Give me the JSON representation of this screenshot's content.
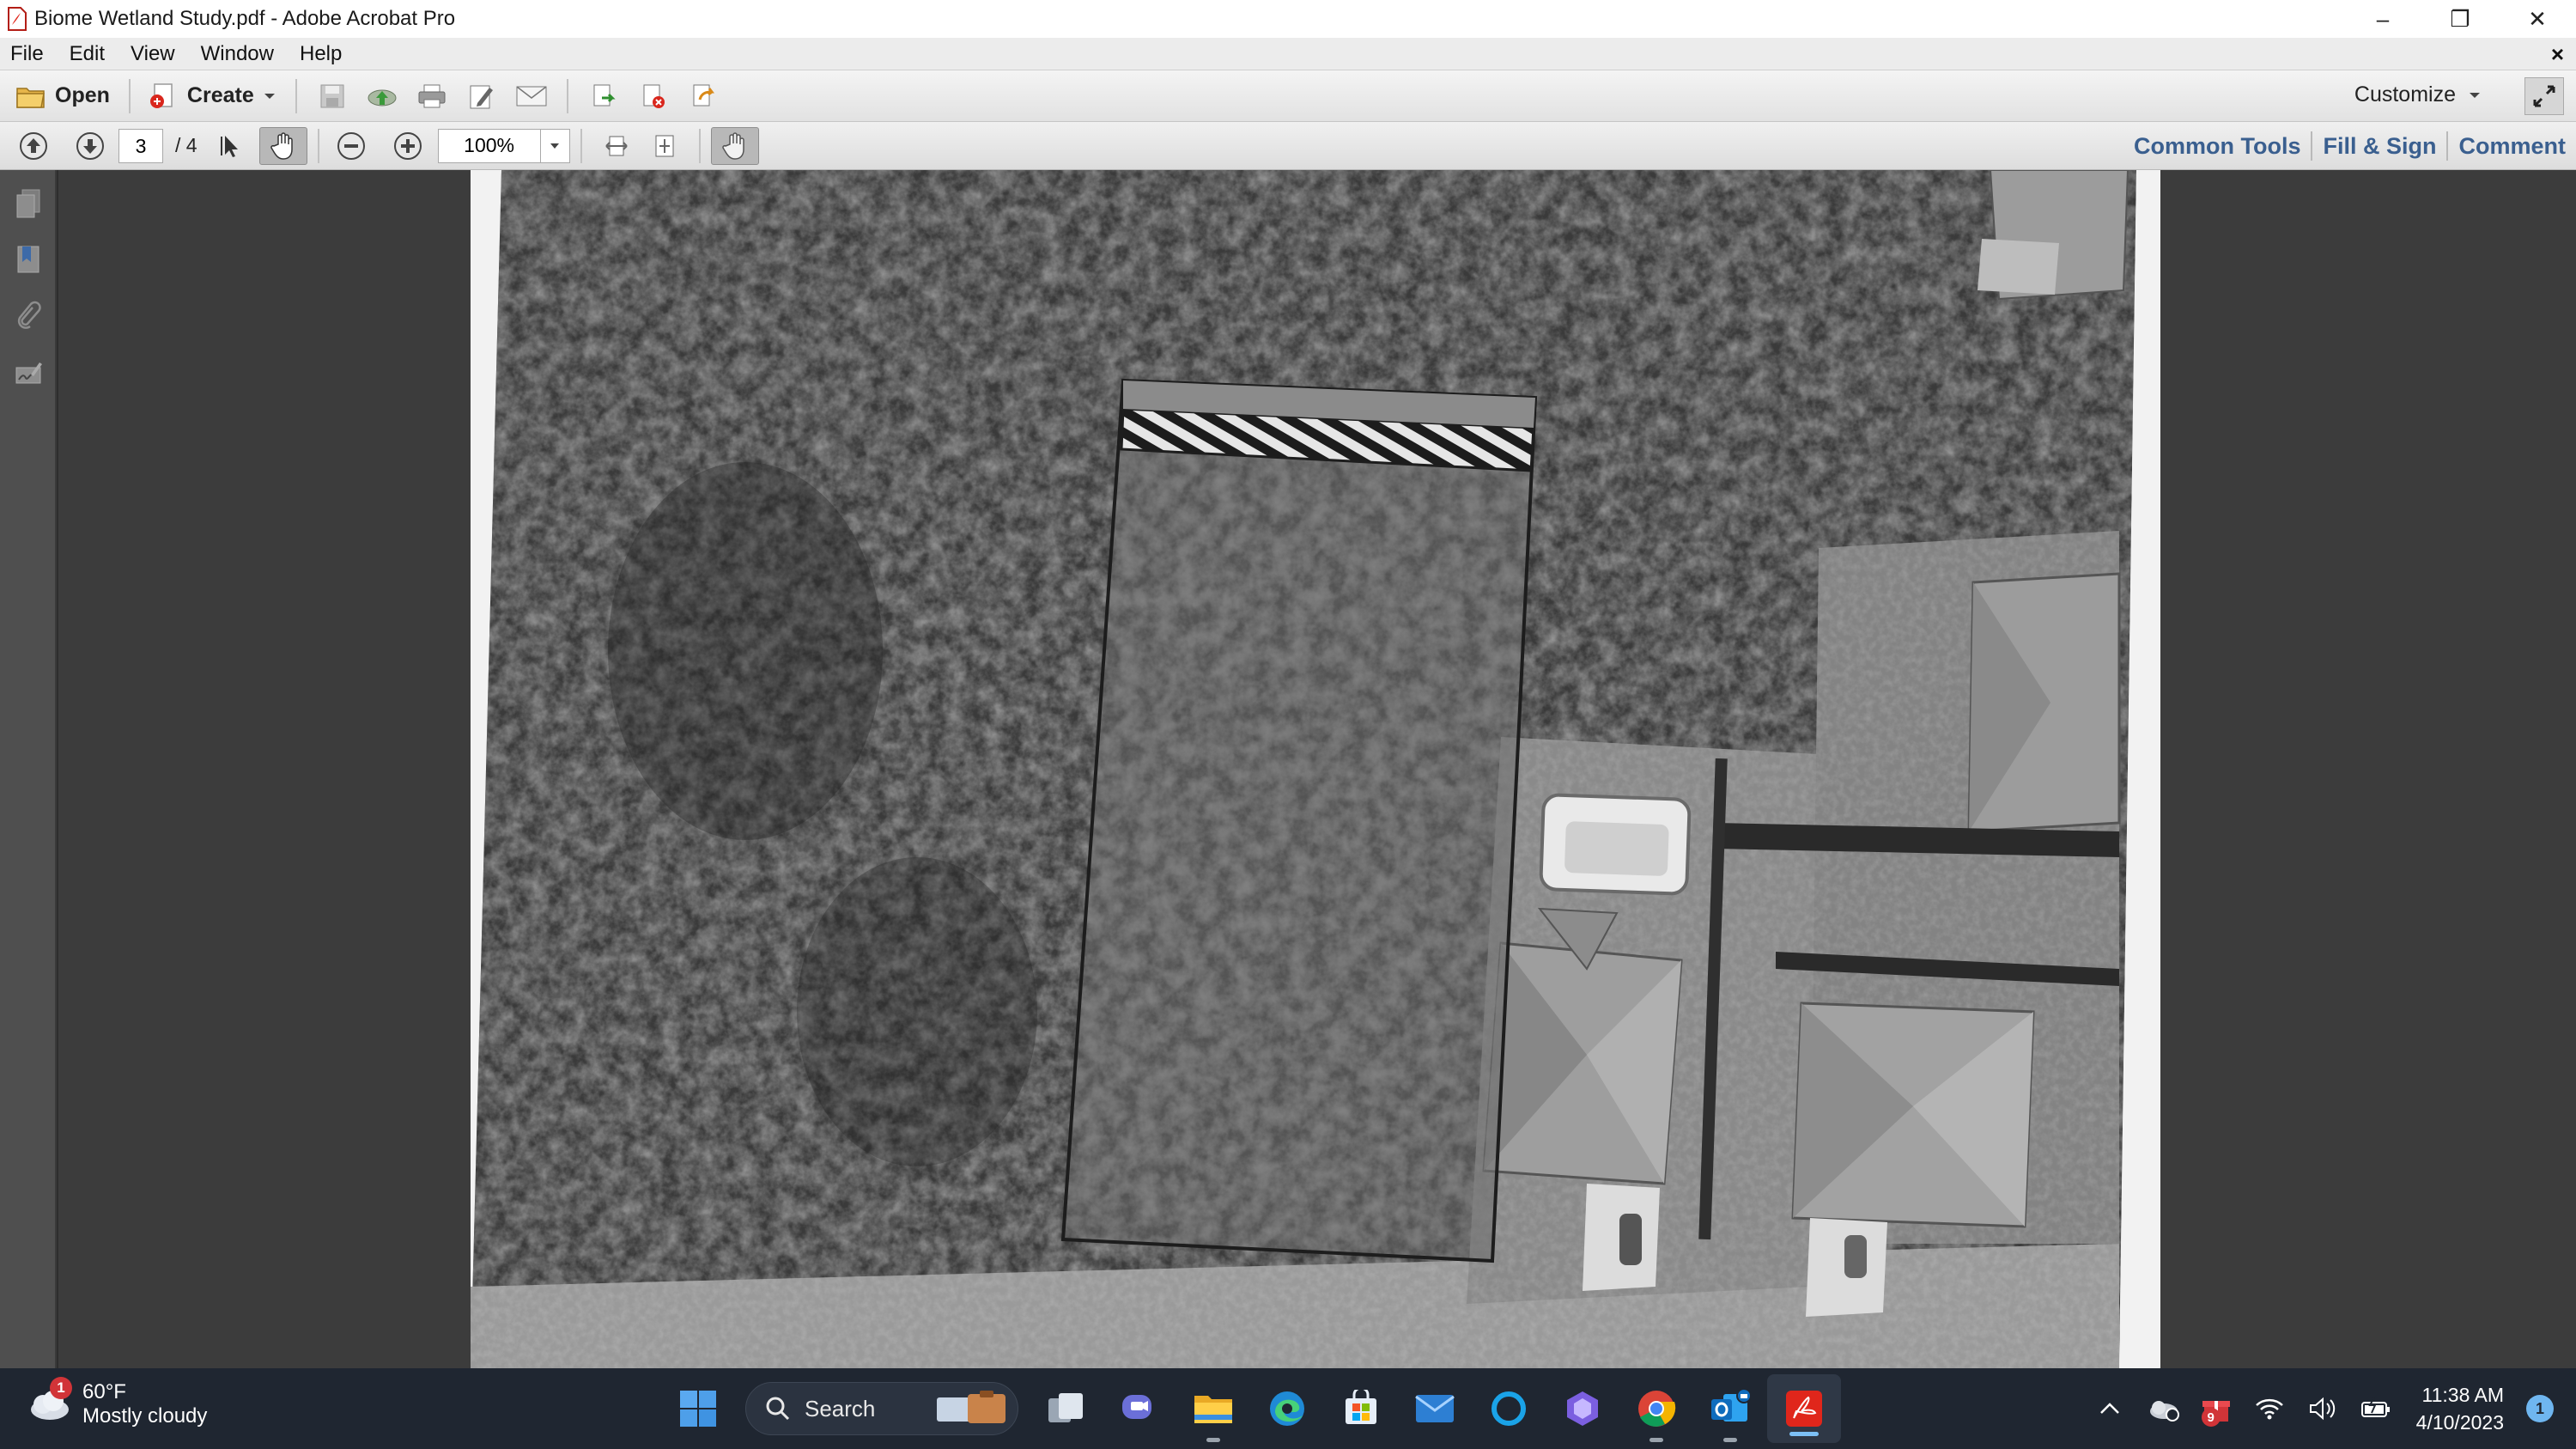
{
  "window": {
    "title": "Biome Wetland Study.pdf - Adobe Acrobat Pro",
    "controls": {
      "minimize": "–",
      "restore": "❐",
      "close": "✕"
    }
  },
  "menu": {
    "items": [
      "File",
      "Edit",
      "View",
      "Window",
      "Help"
    ],
    "doc_close": "×"
  },
  "toolbar": {
    "open_label": "Open",
    "create_label": "Create",
    "customize_label": "Customize",
    "icons": [
      "save-icon",
      "cloud-upload-icon",
      "print-icon",
      "edit-icon",
      "email-icon",
      "export-icon",
      "delete-page-icon",
      "share-icon"
    ]
  },
  "navigation": {
    "current_page": "3",
    "page_total": "/ 4",
    "zoom": "100%"
  },
  "panels": {
    "common_tools": "Common Tools",
    "fill_sign": "Fill & Sign",
    "comment": "Comment"
  },
  "sidebar": {
    "icons": [
      "pages-icon",
      "bookmark-icon",
      "attachment-icon",
      "signature-icon"
    ]
  },
  "taskbar": {
    "weather_badge": "1",
    "temperature": "60°F",
    "condition": "Mostly cloudy",
    "search_label": "Search",
    "apps": [
      "windows-start-icon",
      "file-explorer-icon",
      "edge-icon",
      "microsoft-store-icon",
      "mail-icon",
      "cortana-icon",
      "copilot-icon",
      "chrome-icon",
      "outlook-icon",
      "acrobat-icon"
    ],
    "time": "11:38 AM",
    "date": "4/10/2023",
    "notification_count": "1",
    "tray_badge": "9"
  },
  "colors": {
    "panel_link": "#3a5f8f",
    "taskbar_bg": "#1f2631",
    "doc_bg": "#3c3c3c",
    "acrobat_red": "#e0261b"
  }
}
